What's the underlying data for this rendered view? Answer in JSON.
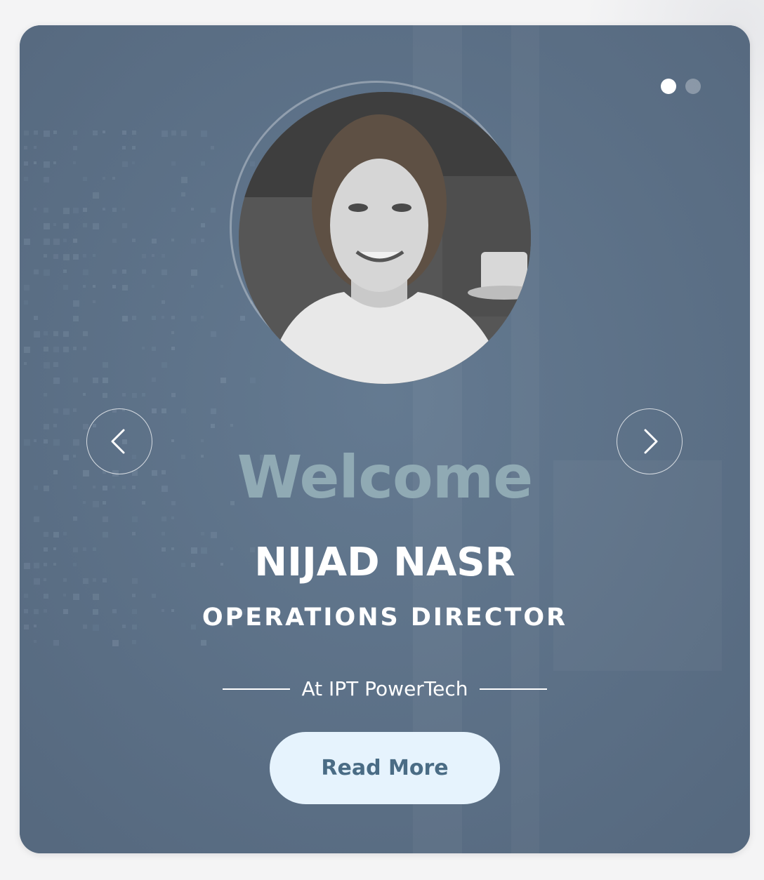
{
  "slider": {
    "dots": [
      {
        "active": true
      },
      {
        "active": false
      }
    ],
    "prev_icon": "chevron-left-icon",
    "next_icon": "chevron-right-icon"
  },
  "profile": {
    "welcome": "Welcome",
    "name": "NIJAD NASR",
    "role": "OPERATIONS DIRECTOR",
    "company": "At IPT PowerTech",
    "read_more_label": "Read More"
  },
  "colors": {
    "card_background": "#5b7189",
    "welcome_text": "#90aab4",
    "button_background": "#e6f3fd",
    "button_text": "#4a6c85"
  }
}
